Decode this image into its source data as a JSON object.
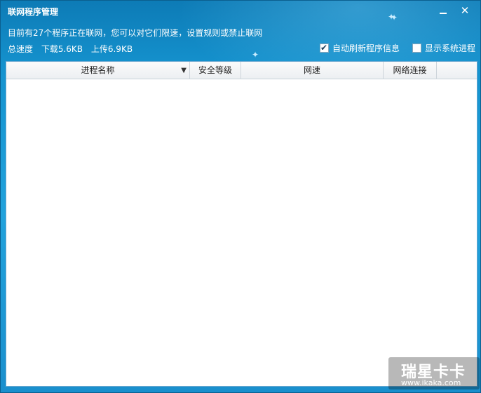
{
  "window": {
    "title": "联网程序管理",
    "minimize_icon": "minimize-icon",
    "close_icon": "close-icon",
    "close_glyph": "✕"
  },
  "summary": {
    "line1": "目前有27个程序正在联网，您可以对它们限速，设置规则或禁止联网",
    "total_label": "总速度",
    "download": "下载5.6KB",
    "upload": "上传6.9KB"
  },
  "options": {
    "auto_refresh": {
      "label": "自动刷新程序信息",
      "checked": true
    },
    "show_system": {
      "label": "显示系统进程",
      "checked": false
    }
  },
  "table": {
    "columns": [
      {
        "label": "进程名称"
      },
      {
        "label": "安全等级"
      },
      {
        "label": "网速"
      },
      {
        "label": "网络连接"
      }
    ],
    "sort_icon": "chevron-down-icon",
    "rows": []
  },
  "watermark": {
    "text": "瑞星卡卡",
    "url": "www.ikaka.com"
  },
  "colors": {
    "window_bg": "#1a93cf",
    "title_text": "#ffffff",
    "table_bg": "#ffffff"
  }
}
